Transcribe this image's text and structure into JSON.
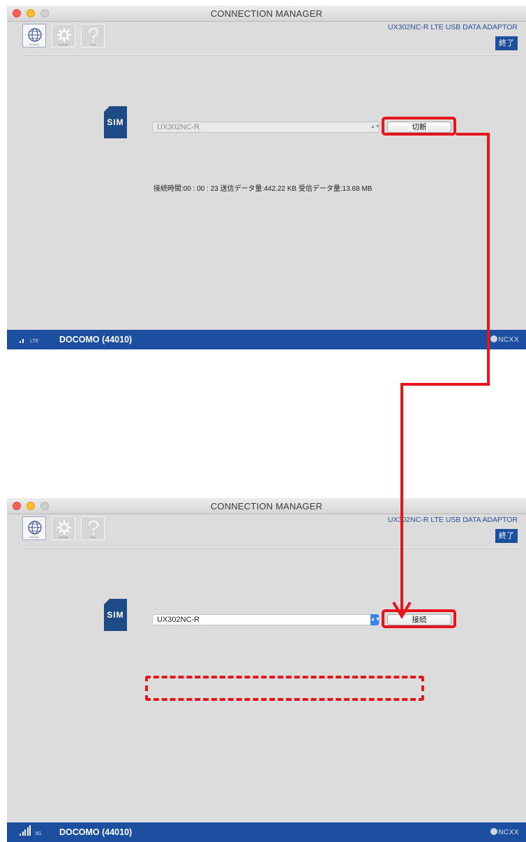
{
  "windows": [
    {
      "title": "CONNECTION MANAGER",
      "toolbar": {
        "network_caption": "Network",
        "settings_caption": "Settings",
        "help_caption": "Help"
      },
      "product": "UX302NC-R LTE USB DATA ADAPTOR",
      "exit_label": "終了",
      "sim_label": "SIM",
      "device": {
        "value": "UX302NC-R",
        "state": "disabled"
      },
      "action_label": "切断",
      "stats": "接続時間:00 : 00 : 23  送信データ量:442.22 KB  受信データ量:13.68 MB",
      "status": {
        "network_type": "LTE",
        "signal_bars": 2,
        "carrier": "DOCOMO (44010)",
        "brand": "NCXX"
      }
    },
    {
      "title": "CONNECTION MANAGER",
      "toolbar": {
        "network_caption": "Network",
        "settings_caption": "Settings",
        "help_caption": "Help"
      },
      "product": "UX302NC-R LTE USB DATA ADAPTOR",
      "exit_label": "終了",
      "sim_label": "SIM",
      "device": {
        "value": "UX302NC-R",
        "state": "enabled"
      },
      "action_label": "接続",
      "stats": "",
      "status": {
        "network_type": "3G",
        "signal_bars": 5,
        "carrier": "DOCOMO (44010)",
        "brand": "NCXX"
      }
    }
  ],
  "colors": {
    "accent": "#1d4fa0",
    "highlight": "#e8141b",
    "window_bg": "#dcdcdc"
  }
}
